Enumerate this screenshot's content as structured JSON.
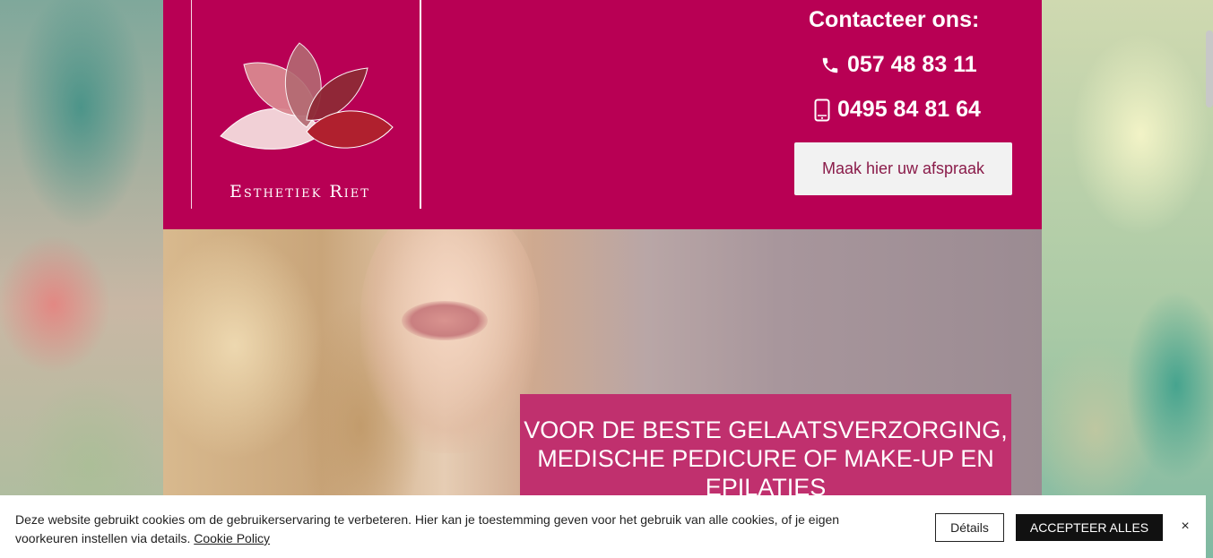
{
  "header": {
    "brand": "Esthetiek Riet",
    "contact_title": "Contacteer ons:",
    "phone_landline": "057 48 83 11",
    "phone_mobile": "0495 84 81 64",
    "phone_icon": "phone-icon",
    "mobile_icon": "mobile-phone-icon",
    "cta_label": "Maak hier uw afspraak",
    "colors": {
      "brand": "#b80054",
      "caption": "#c0306e"
    }
  },
  "hero": {
    "caption": "VOOR DE BESTE GELAATSVERZORGING, MEDISCHE PEDICURE OF MAKE-UP EN EPILATIES"
  },
  "cookie": {
    "text": "Deze website gebruikt cookies om de gebruikerservaring te verbeteren. Hier kan je toestemming geven voor het gebruik van alle cookies, of je eigen voorkeuren instellen via details.",
    "link_label": "Cookie Policy",
    "details_label": "Détails",
    "accept_label": "ACCEPTEER ALLES",
    "close_label": "×"
  }
}
